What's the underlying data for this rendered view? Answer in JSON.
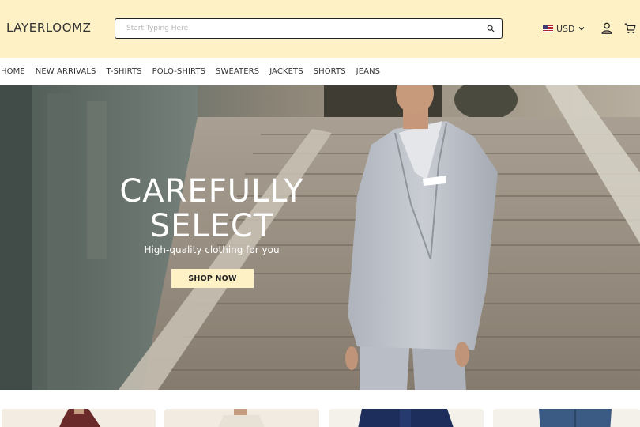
{
  "header": {
    "brand": "LAYERLOOMZ",
    "search": {
      "placeholder": "Start Typing Here",
      "value": ""
    },
    "currency": {
      "label": "USD",
      "flag": "us-flag-icon"
    }
  },
  "nav": {
    "items": [
      "HOME",
      "NEW ARRIVALS",
      "T-SHIRTS",
      "POLO-SHIRTS",
      "SWEATERS",
      "JACKETS",
      "SHORTS",
      "JEANS"
    ]
  },
  "hero": {
    "title_line1": "CAREFULLY",
    "title_line2": "SELECT",
    "subtitle": "High-quality clothing for you",
    "cta": "SHOP NOW"
  },
  "products": {
    "count_visible": 4
  },
  "colors": {
    "header_bg": "#fdf1c5",
    "accent": "#fdf1c5",
    "text": "#333333"
  }
}
